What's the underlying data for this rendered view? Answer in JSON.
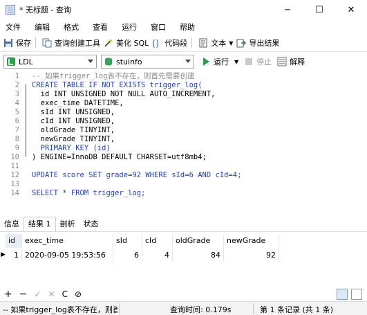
{
  "window": {
    "title": "* 无标题 - 查询",
    "minimize": "−",
    "maximize": "☐",
    "close": "✕"
  },
  "menu": [
    "文件",
    "编辑",
    "格式",
    "查看",
    "运行",
    "窗口",
    "帮助"
  ],
  "toolbar": {
    "save": "保存",
    "query_builder": "查询创建工具",
    "beautify_sql": "美化 SQL",
    "code_snippet": "代码段",
    "text": "文本",
    "export_result": "导出结果"
  },
  "connection": {
    "connection_name": "LDL",
    "database": "stuinfo",
    "run": "运行",
    "stop": "停止",
    "explain": "解释"
  },
  "editor": {
    "line_numbers": [
      "1",
      "2",
      "3",
      "4",
      "5",
      "6",
      "7",
      "8",
      "9",
      "10",
      "11",
      "12",
      "13",
      "14"
    ],
    "lines": [
      "-- 如果trigger_log表不存在，则首先需要创建",
      "CREATE TABLE IF NOT EXISTS trigger_log(",
      "  id INT UNSIGNED NOT NULL AUTO_INCREMENT,",
      "  exec_time DATETIME,",
      "  sId INT UNSIGNED,",
      "  cId INT UNSIGNED,",
      "  oldGrade TINYINT,",
      "  newGrade TINYINT,",
      "  PRIMARY KEY (id)",
      ") ENGINE=InnoDB DEFAULT CHARSET=utf8mb4;",
      "",
      "UPDATE score SET grade=92 WHERE sId=6 AND cId=4;",
      "",
      "SELECT * FROM trigger_log;"
    ]
  },
  "result_tabs": [
    "信息",
    "结果 1",
    "剖析",
    "状态"
  ],
  "grid": {
    "columns": [
      "id",
      "exec_time",
      "sId",
      "cId",
      "oldGrade",
      "newGrade"
    ],
    "rows": [
      [
        "1",
        "2020-09-05 19:53:56",
        "6",
        "4",
        "84",
        "92"
      ]
    ]
  },
  "grid_controls": [
    "+",
    "−",
    "✓",
    "✕",
    "C",
    "⊘"
  ],
  "status": {
    "message": "-- 如果trigger_log表不存在，则首先",
    "query_time": "查询时间: 0.179s",
    "record": "第 1 条记录 (共 1 条)"
  }
}
